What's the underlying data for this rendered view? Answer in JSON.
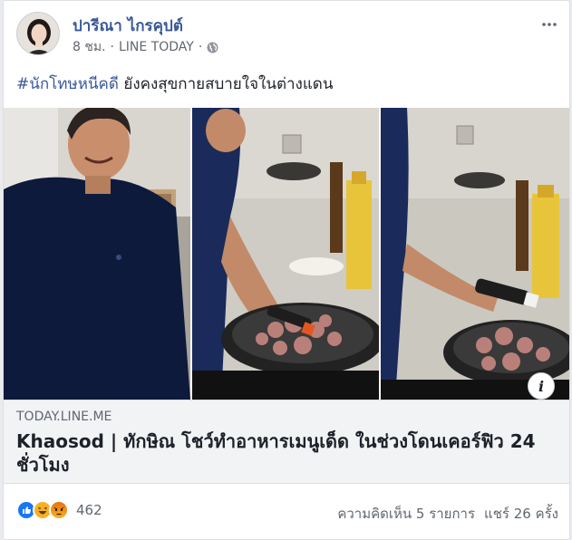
{
  "post": {
    "author": "ปารีณา ไกรคุปต์",
    "time": "8 ชม.",
    "separator": "·",
    "source": "LINE TODAY",
    "privacy_icon": "globe-icon",
    "more_icon": "more-options-icon",
    "hashtag": "#นักโทษหนีคดี",
    "text": " ยังคงสุขกายสบายใจในต่างแดน"
  },
  "link": {
    "domain": "TODAY.LINE.ME",
    "headline": "Khaosod | ทักษิณ โชว์ทำอาหารเมนูเด็ด ในช่วงโดนเคอร์ฟิว 24 ชั่วโมง",
    "info_label": "i"
  },
  "footer": {
    "reaction_icons": [
      "like-icon",
      "haha-icon",
      "angry-icon"
    ],
    "reaction_count": "462",
    "comments": "ความคิดเห็น 5 รายการ",
    "shares": "แชร์ 26 ครั้ง"
  },
  "colors": {
    "link_blue": "#385898",
    "like_blue": "#1877f2",
    "haha_yellow": "#f7b125",
    "angry_red": "#e9710f"
  }
}
